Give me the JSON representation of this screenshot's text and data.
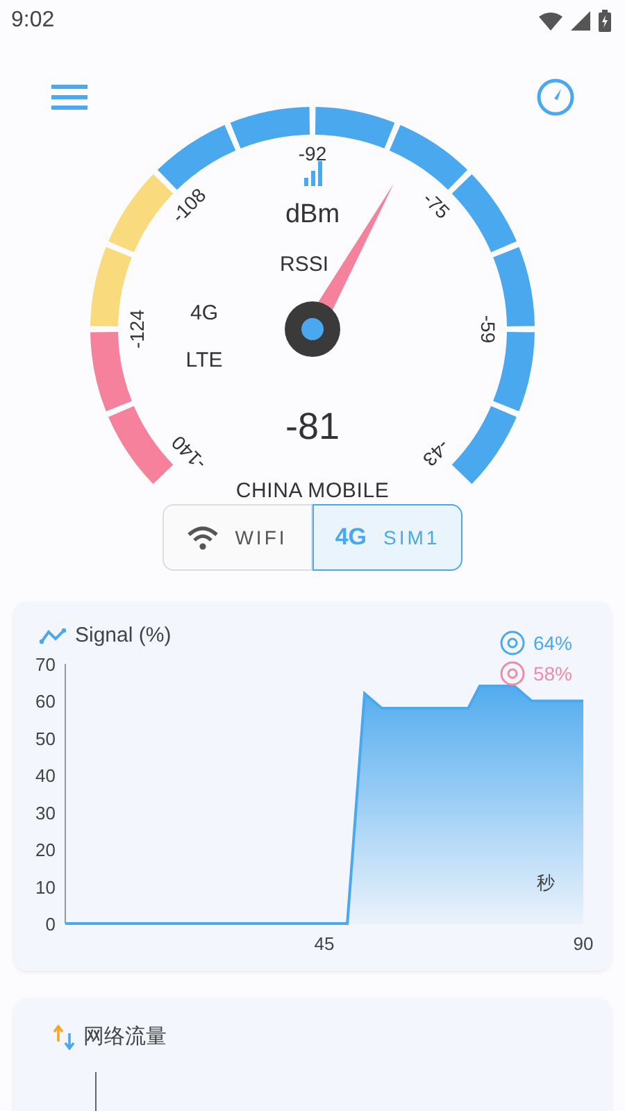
{
  "status_bar": {
    "time": "9:02"
  },
  "gauge": {
    "unit": "dBm",
    "metric": "RSSI",
    "network": "4G",
    "technology": "LTE",
    "reading": "-81",
    "scale": [
      "-140",
      "-124",
      "-108",
      "-92",
      "-75",
      "-59",
      "-43"
    ],
    "segments": [
      {
        "color": "#f5819d"
      },
      {
        "color": "#f5819d"
      },
      {
        "color": "#f9da7c"
      },
      {
        "color": "#f9da7c"
      },
      {
        "color": "#4aa8ee"
      },
      {
        "color": "#4aa8ee"
      },
      {
        "color": "#4aa8ee"
      },
      {
        "color": "#4aa8ee"
      },
      {
        "color": "#4aa8ee"
      },
      {
        "color": "#4aa8ee"
      },
      {
        "color": "#4aa8ee"
      },
      {
        "color": "#4aa8ee"
      }
    ]
  },
  "carrier": "CHINA MOBILE",
  "tabs": [
    {
      "kind": "wifi",
      "label": "WIFI",
      "selected": false
    },
    {
      "kind": "sim",
      "badge": "4G",
      "label": "SIM1",
      "selected": true
    }
  ],
  "signal_card": {
    "title": "Signal (%)",
    "legend": [
      {
        "value": "64%",
        "color": "#4aa8ee"
      },
      {
        "value": "58%",
        "color": "#f08aa6"
      }
    ],
    "chart_data": {
      "type": "area",
      "xlabel": "秒",
      "x": [
        0,
        47,
        49,
        52,
        55,
        70,
        72,
        78,
        81,
        90
      ],
      "series": [
        {
          "color": "#4aa8ee",
          "values": [
            0,
            0,
            0,
            62,
            58,
            58,
            64,
            64,
            60,
            60
          ]
        }
      ],
      "xlim": [
        0,
        90
      ],
      "ylim": [
        0,
        70
      ],
      "xticks": [
        45,
        90
      ],
      "yticks": [
        0,
        10,
        20,
        30,
        40,
        50,
        60,
        70
      ]
    }
  },
  "traffic_card": {
    "title": "网络流量"
  }
}
